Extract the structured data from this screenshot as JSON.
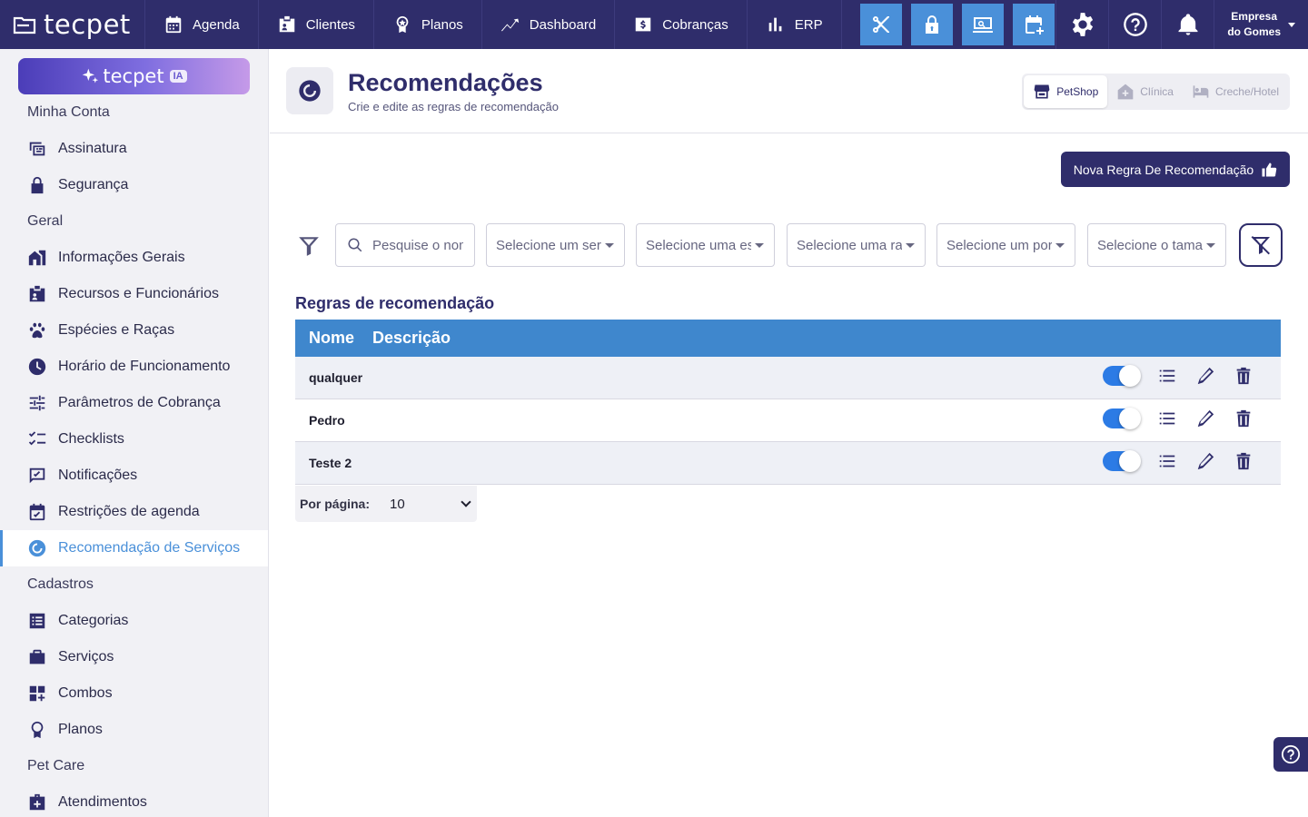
{
  "brand": {
    "logo_text": "tecpet"
  },
  "nav": [
    {
      "label": "Agenda"
    },
    {
      "label": "Clientes"
    },
    {
      "label": "Planos"
    },
    {
      "label": "Dashboard"
    },
    {
      "label": "Cobranças"
    },
    {
      "label": "ERP"
    }
  ],
  "company": {
    "line1": "Empresa",
    "line2": "do Gomes"
  },
  "sidebar": {
    "ia_text": "tecpet",
    "ia_badge": "IA",
    "sections": {
      "minha_conta": "Minha Conta",
      "geral": "Geral",
      "cadastros": "Cadastros",
      "pet_care": "Pet Care"
    },
    "items": {
      "assinatura": "Assinatura",
      "seguranca": "Segurança",
      "informacoes": "Informações Gerais",
      "recursos": "Recursos e Funcionários",
      "especies": "Espécies e Raças",
      "horario": "Horário de Funcionamento",
      "parametros": "Parâmetros de Cobrança",
      "checklists": "Checklists",
      "notificacoes": "Notificações",
      "restricoes": "Restrições de agenda",
      "recomendacao": "Recomendação de Serviços",
      "categorias": "Categorias",
      "servicos": "Serviços",
      "combos": "Combos",
      "planos": "Planos",
      "atendimentos": "Atendimentos"
    }
  },
  "page": {
    "title": "Recomendações",
    "subtitle": "Crie e edite as regras de recomendação",
    "segments": {
      "petshop": "PetShop",
      "clinica": "Clínica",
      "creche": "Creche/Hotel"
    },
    "new_rule_label": "Nova Regra De Recomendação"
  },
  "filters": {
    "search_placeholder": "Pesquise o nome",
    "selects": [
      "Selecione um serviço",
      "Selecione uma espécie",
      "Selecione uma raça",
      "Selecione um porte",
      "Selecione o tamanho"
    ]
  },
  "table": {
    "title": "Regras de recomendação",
    "columns": {
      "name": "Nome",
      "description": "Descrição"
    },
    "rows": [
      {
        "name": "qualquer",
        "active": true
      },
      {
        "name": "Pedro",
        "active": true
      },
      {
        "name": "Teste 2",
        "active": true
      }
    ]
  },
  "pagination": {
    "label": "Por página:",
    "value": "10"
  },
  "colors": {
    "primary": "#2f2d6b",
    "accent": "#4a90d9",
    "table_header": "#3f87cd",
    "toggle_on": "#2c7be5"
  }
}
